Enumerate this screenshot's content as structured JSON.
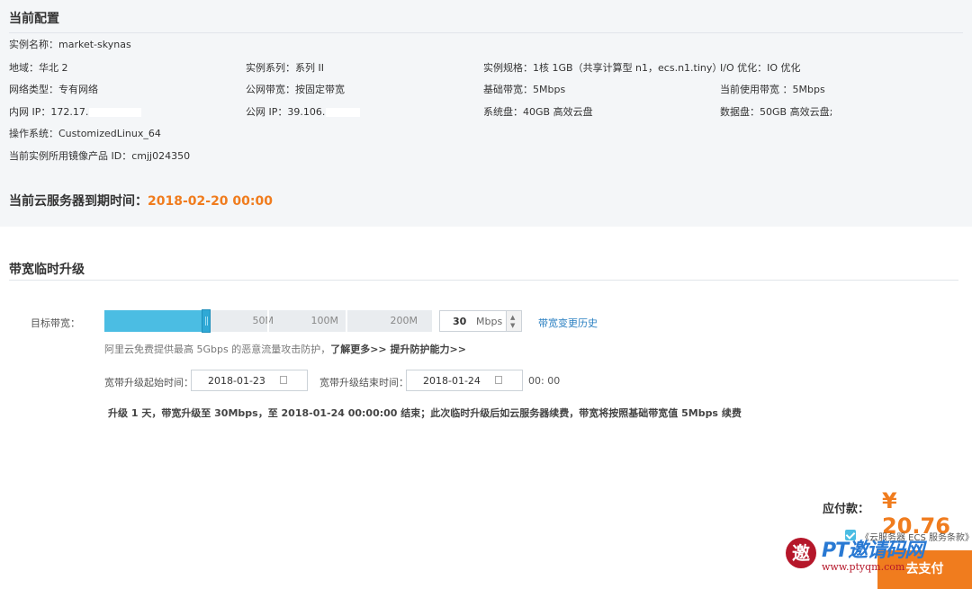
{
  "config": {
    "title": "当前配置",
    "instance_name": {
      "label": "实例名称：",
      "value": "market-skynas"
    },
    "region": {
      "label": "地域：",
      "value": "华北 2"
    },
    "series": {
      "label": "实例系列：",
      "value": "系列 II"
    },
    "spec": {
      "label": "实例规格：",
      "value": "1核 1GB（共享计算型 n1，ecs.n1.tiny）"
    },
    "io": {
      "label": "I/O 优化：",
      "value": "IO 优化"
    },
    "network_type": {
      "label": "网络类型：",
      "value": "专有网络"
    },
    "public_bandwidth": {
      "label": "公网带宽：",
      "value": "按固定带宽"
    },
    "base_bandwidth": {
      "label": "基础带宽：",
      "value": "5Mbps"
    },
    "current_bandwidth": {
      "label": "当前使用带宽 ：",
      "value": "5Mbps"
    },
    "private_ip": {
      "label": "内网 IP：",
      "value": "172.17."
    },
    "public_ip": {
      "label": "公网 IP：",
      "value": "39.106."
    },
    "system_disk": {
      "label": "系统盘：",
      "value": "40GB 高效云盘"
    },
    "data_disk": {
      "label": "数据盘：",
      "value": "50GB 高效云盘;"
    },
    "os": {
      "label": "操作系统：",
      "value": "CustomizedLinux_64"
    },
    "image_id": {
      "label": "当前实例所用镜像产品 ID：",
      "value": "cmjj024350"
    },
    "expire": {
      "label": "当前云服务器到期时间：",
      "value": "2018-02-20 00:00"
    }
  },
  "upgrade": {
    "title": "带宽临时升级",
    "target_label": "目标带宽：",
    "slider": {
      "marks": [
        "50M",
        "100M",
        "200M"
      ],
      "max_mbps": 200,
      "fill_fraction": 0.31
    },
    "value": "30",
    "unit": "Mbps",
    "history_link": "带宽变更历史",
    "note_text": "阿里云免费提供最高 5Gbps 的恶意流量攻击防护，",
    "note_link": "了解更多>> 提升防护能力>>",
    "start_label": "宽带升级起始时间：",
    "start_date": "2018-01-23",
    "end_label": "宽带升级结束时间：",
    "end_date": "2018-01-24",
    "end_time": "00: 00",
    "summary": "升级 1 天，带宽升级至 30Mbps，至 2018-01-24 00:00:00 结束；此次临时升级后如云服务器续费，带宽将按照基础带宽值 5Mbps 续费"
  },
  "payment": {
    "label": "应付款：",
    "amount": "¥ 20.76",
    "agreement": "《云服务器 ECS 服务条款》",
    "button": "去支付"
  },
  "watermark": {
    "logo_char": "邀",
    "text": "PT邀请码网",
    "url": "www.ptyqm.com"
  },
  "colors": {
    "accent": "#4bbde3",
    "price": "#f07c1e",
    "link": "#2a7fc1"
  }
}
